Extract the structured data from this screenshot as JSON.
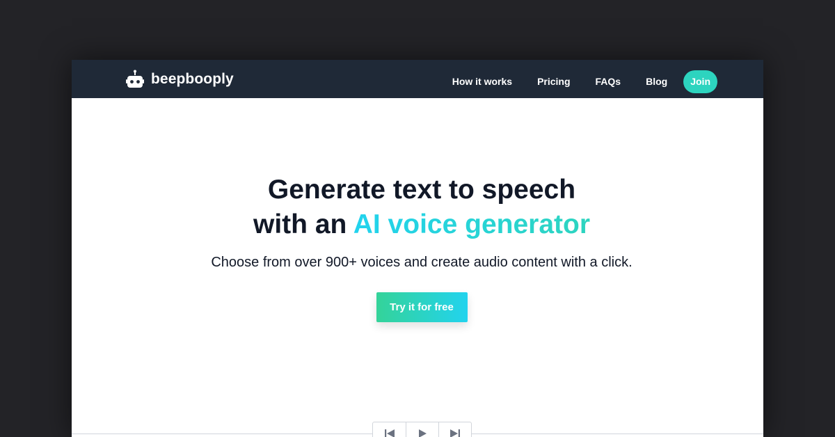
{
  "brand": {
    "name": "beepbooply",
    "logo_icon": "robot-icon"
  },
  "nav": {
    "links": [
      "How it works",
      "Pricing",
      "FAQs",
      "Blog"
    ],
    "join_label": "Join"
  },
  "hero": {
    "headline_line1": "Generate text to speech",
    "headline_line2_prefix": "with an ",
    "headline_line2_accent": "AI voice generator",
    "subtitle": "Choose from over 900+ voices and create audio content with a click.",
    "cta_label": "Try it for free"
  },
  "player": {
    "controls": [
      "skip-back-icon",
      "play-icon",
      "skip-forward-icon"
    ]
  },
  "colors": {
    "navbar_bg": "#1f2937",
    "accent_teal": "#2dd4bf",
    "accent_cyan": "#22d3ee",
    "page_bg": "#232327",
    "heading_text": "#111827"
  }
}
